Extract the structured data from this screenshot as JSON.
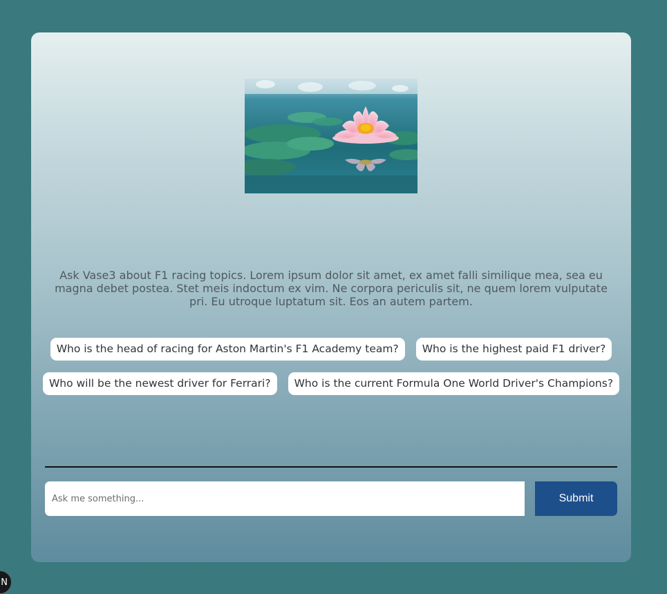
{
  "hero_image": {
    "alt": "pink-lotus-on-water"
  },
  "description": "Ask Vase3 about F1 racing topics. Lorem ipsum dolor sit amet, ex amet falli similique mea, sea eu magna debet postea. Stet meis indoctum ex vim. Ne corpora periculis sit, ne quem lorem vulputate pri. Eu utroque luptatum sit. Eos an autem partem.",
  "suggestions": [
    "Who is the head of racing for Aston Martin's F1 Academy team?",
    "Who is the highest paid F1 driver?",
    "Who will be the newest driver for Ferrari?",
    "Who is the current Formula One World Driver's Champions?"
  ],
  "input": {
    "placeholder": "Ask me something..."
  },
  "submit_label": "Submit",
  "corner_badge": "N",
  "colors": {
    "background": "#3a7a7e",
    "button": "#1d4f8b"
  }
}
